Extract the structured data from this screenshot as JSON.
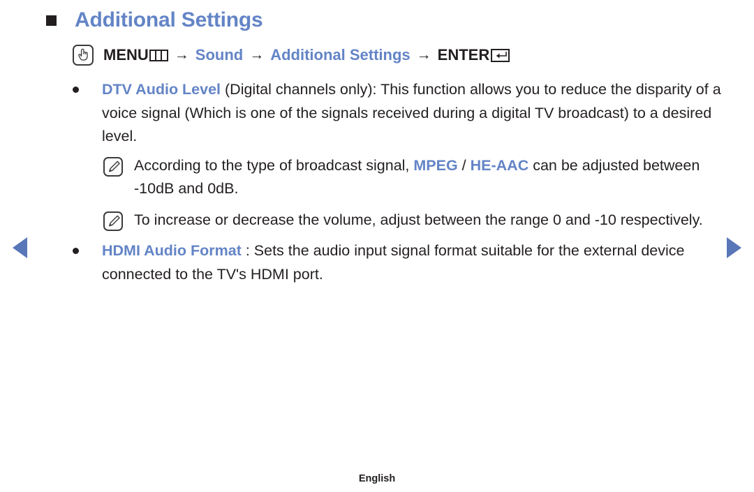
{
  "heading": {
    "title": "Additional Settings",
    "bullet_icon": "square-bullet-icon"
  },
  "menu_path": {
    "remote_icon": "hand-press-icon",
    "menu_label": "MENU",
    "menu_glyph_icon": "menu-grid-icon",
    "arrow": "→",
    "step_sound": "Sound",
    "step_additional_settings": "Additional Settings",
    "enter_label": "ENTER",
    "enter_glyph_icon": "enter-return-icon"
  },
  "items": [
    {
      "bullet_icon": "round-bullet-icon",
      "term": "DTV Audio Level",
      "description": " (Digital channels only): This function allows you to reduce the disparity of a voice signal (Which is one of the signals received during a digital TV broadcast) to a desired level.",
      "notes": [
        {
          "icon": "note-pencil-icon",
          "text_before": "According to the type of broadcast signal, ",
          "term1": "MPEG",
          "separator": " / ",
          "term2": "HE-AAC",
          "text_after": " can be adjusted between -10dB and 0dB."
        },
        {
          "icon": "note-pencil-icon",
          "text_before": "To increase or decrease the volume, adjust between the range 0 and -10 respectively.",
          "term1": "",
          "separator": "",
          "term2": "",
          "text_after": ""
        }
      ]
    },
    {
      "bullet_icon": "round-bullet-icon",
      "term": "HDMI Audio Format",
      "description": " : Sets the audio input signal format suitable for the external device connected to the TV's HDMI port.",
      "notes": []
    }
  ],
  "navigation": {
    "prev_icon": "arrow-left-icon",
    "next_icon": "arrow-right-icon"
  },
  "footer": {
    "language": "English"
  },
  "colors": {
    "accent_blue": "#6384c6",
    "arrow_blue": "#5876b8",
    "text_black": "#231f20"
  }
}
